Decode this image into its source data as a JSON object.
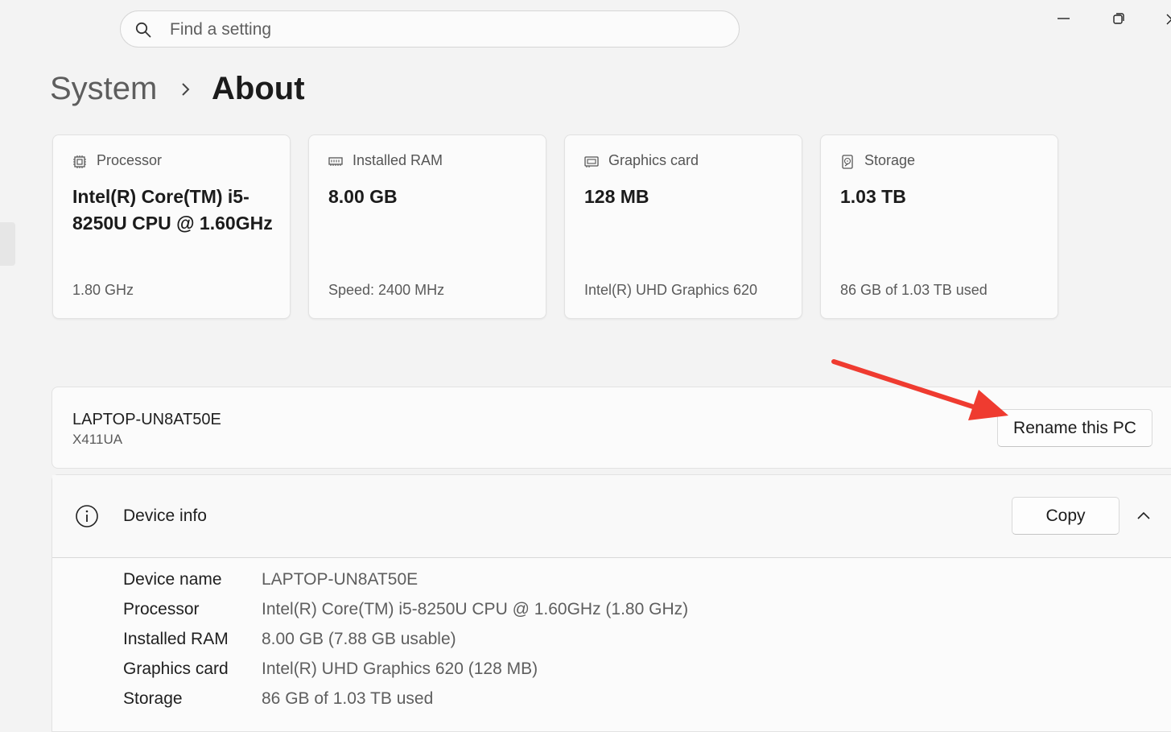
{
  "search": {
    "placeholder": "Find a setting"
  },
  "window_controls": {
    "minimize_icon": "minimize-icon",
    "restore_icon": "restore-icon",
    "close_icon": "close-icon"
  },
  "breadcrumb": {
    "parent": "System",
    "current": "About"
  },
  "spec_cards": [
    {
      "icon": "processor-icon",
      "label": "Processor",
      "value": "Intel(R) Core(TM) i5-8250U CPU @ 1.60GHz",
      "sub": "1.80 GHz"
    },
    {
      "icon": "ram-icon",
      "label": "Installed RAM",
      "value": "8.00 GB",
      "sub": "Speed: 2400 MHz"
    },
    {
      "icon": "graphics-card-icon",
      "label": "Graphics card",
      "value": "128 MB",
      "sub": "Intel(R) UHD Graphics 620"
    },
    {
      "icon": "storage-icon",
      "label": "Storage",
      "value": "1.03 TB",
      "sub": "86 GB of 1.03 TB used"
    }
  ],
  "pc": {
    "name": "LAPTOP-UN8AT50E",
    "model": "X411UA",
    "rename_label": "Rename this PC"
  },
  "device_info": {
    "title": "Device info",
    "copy_label": "Copy",
    "rows": [
      {
        "label": "Device name",
        "value": "LAPTOP-UN8AT50E"
      },
      {
        "label": "Processor",
        "value": "Intel(R) Core(TM) i5-8250U CPU @ 1.60GHz (1.80 GHz)"
      },
      {
        "label": "Installed RAM",
        "value": "8.00 GB (7.88 GB usable)"
      },
      {
        "label": "Graphics card",
        "value": "Intel(R) UHD Graphics 620 (128 MB)"
      },
      {
        "label": "Storage",
        "value": "86 GB of 1.03 TB used"
      }
    ]
  },
  "annotation": {
    "arrow_color": "#ef3b30"
  }
}
